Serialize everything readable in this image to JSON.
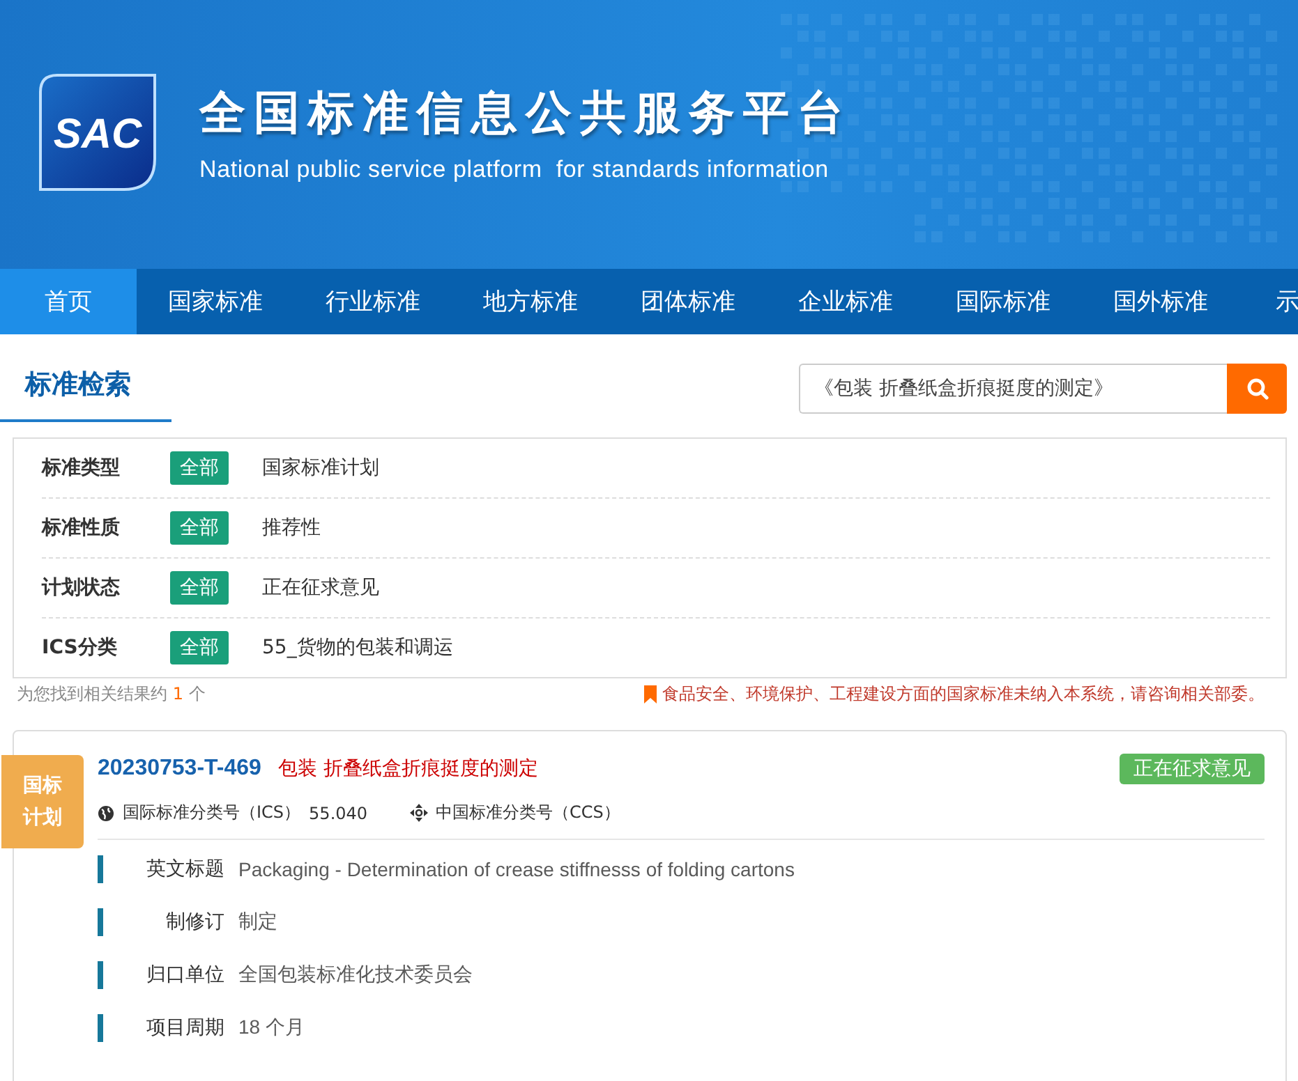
{
  "header": {
    "logo_text": "SAC",
    "title": "全国标准信息公共服务平台",
    "subtitle": "National public service platform  for standards information"
  },
  "nav": [
    {
      "label": "首页",
      "selected": true
    },
    {
      "label": "国家标准",
      "selected": false
    },
    {
      "label": "行业标准",
      "selected": false
    },
    {
      "label": "地方标准",
      "selected": false
    },
    {
      "label": "团体标准",
      "selected": false
    },
    {
      "label": "企业标准",
      "selected": false
    },
    {
      "label": "国际标准",
      "selected": false
    },
    {
      "label": "国外标准",
      "selected": false
    },
    {
      "label": "示",
      "selected": false
    }
  ],
  "search": {
    "heading": "标准检索",
    "value": "《包装 折叠纸盒折痕挺度的测定》"
  },
  "filters": [
    {
      "label": "标准类型",
      "badge": "全部",
      "value": "国家标准计划"
    },
    {
      "label": "标准性质",
      "badge": "全部",
      "value": "推荐性"
    },
    {
      "label": "计划状态",
      "badge": "全部",
      "value": "正在征求意见"
    },
    {
      "label": "ICS分类",
      "badge": "全部",
      "value": "55_货物的包装和调运"
    }
  ],
  "result_summary": {
    "prefix": "为您找到相关结果约",
    "count": "1",
    "suffix": "个"
  },
  "notice": "食品安全、环境保护、工程建设方面的国家标准未纳入本系统，请咨询相关部委。",
  "results": [
    {
      "ribbon": "国标计划",
      "code": "20230753-T-469",
      "title": "包装 折叠纸盒折痕挺度的测定",
      "status": "正在征求意见",
      "ics_label": "国际标准分类号（ICS）",
      "ics_value": "55.040",
      "ccs_label": "中国标准分类号（CCS）",
      "fields": [
        {
          "label": "英文标题",
          "value": "Packaging - Determination of crease stiffnesss of folding cartons"
        },
        {
          "label": "制修订",
          "value": "制定"
        },
        {
          "label": "归口单位",
          "value": "全国包装标准化技术委员会"
        },
        {
          "label": "项目周期",
          "value": "18 个月"
        }
      ]
    }
  ]
}
